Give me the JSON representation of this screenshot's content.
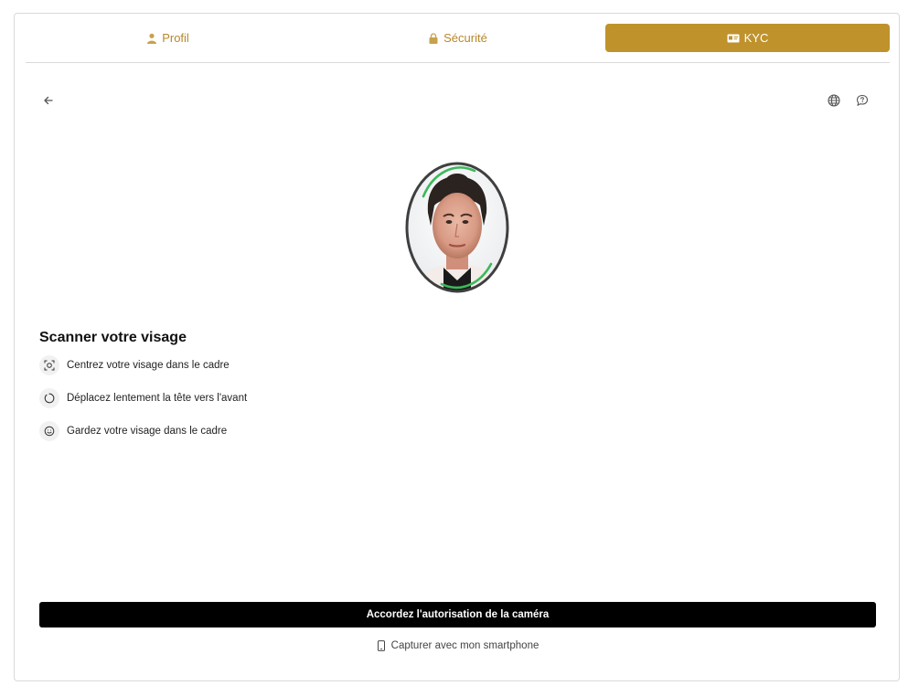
{
  "tabs": [
    {
      "label": "Profil",
      "icon": "user-icon",
      "active": false
    },
    {
      "label": "Sécurité",
      "icon": "lock-icon",
      "active": false
    },
    {
      "label": "KYC",
      "icon": "id-card-icon",
      "active": true
    }
  ],
  "colors": {
    "accent": "#bf922c",
    "button_bg": "#000000",
    "scan_arc": "#3db85c"
  },
  "scan": {
    "title": "Scanner votre visage",
    "instructions": [
      {
        "icon": "face-scan-icon",
        "text": "Centrez votre visage dans le cadre"
      },
      {
        "icon": "circle-progress-icon",
        "text": "Déplacez lentement la tête vers l'avant"
      },
      {
        "icon": "smile-icon",
        "text": "Gardez votre visage dans le cadre"
      }
    ]
  },
  "actions": {
    "camera_permission": "Accordez l'autorisation de la caméra",
    "smartphone_capture": "Capturer avec mon smartphone"
  }
}
